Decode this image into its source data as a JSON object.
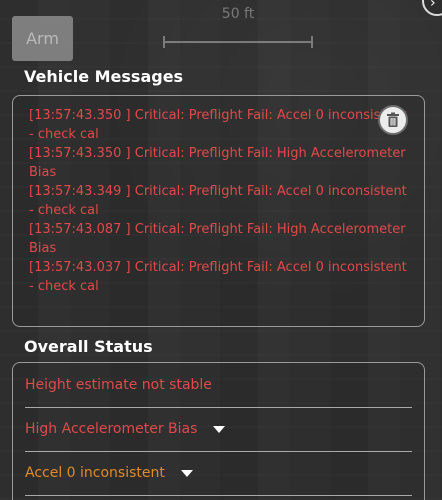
{
  "map": {
    "scale_label": "50 ft"
  },
  "arm_button": {
    "label": "Arm"
  },
  "vehicle_messages": {
    "title": "Vehicle Messages",
    "messages": [
      "[13:57:43.350 ] Critical: Preflight Fail: Accel 0 inconsistent - check cal",
      "[13:57:43.350 ] Critical: Preflight Fail: High Accelerometer Bias",
      "[13:57:43.349 ] Critical: Preflight Fail: Accel 0 inconsistent - check cal",
      "[13:57:43.087 ] Critical: Preflight Fail: High Accelerometer Bias",
      "[13:57:43.037 ] Critical: Preflight Fail: Accel 0 inconsistent - check cal"
    ],
    "message_color": "#e04a4a"
  },
  "overall_status": {
    "title": "Overall Status",
    "items": [
      {
        "label": "Height estimate not stable",
        "color": "#e04a4a",
        "expandable": false
      },
      {
        "label": "High Accelerometer Bias",
        "color": "#e04a4a",
        "expandable": true
      },
      {
        "label": "Accel 0 inconsistent",
        "color": "#e08a2a",
        "expandable": true
      }
    ]
  },
  "icons": {
    "clear_messages": "trash-icon",
    "expand": "caret-down-icon",
    "corner": "chevron-right-icon"
  }
}
